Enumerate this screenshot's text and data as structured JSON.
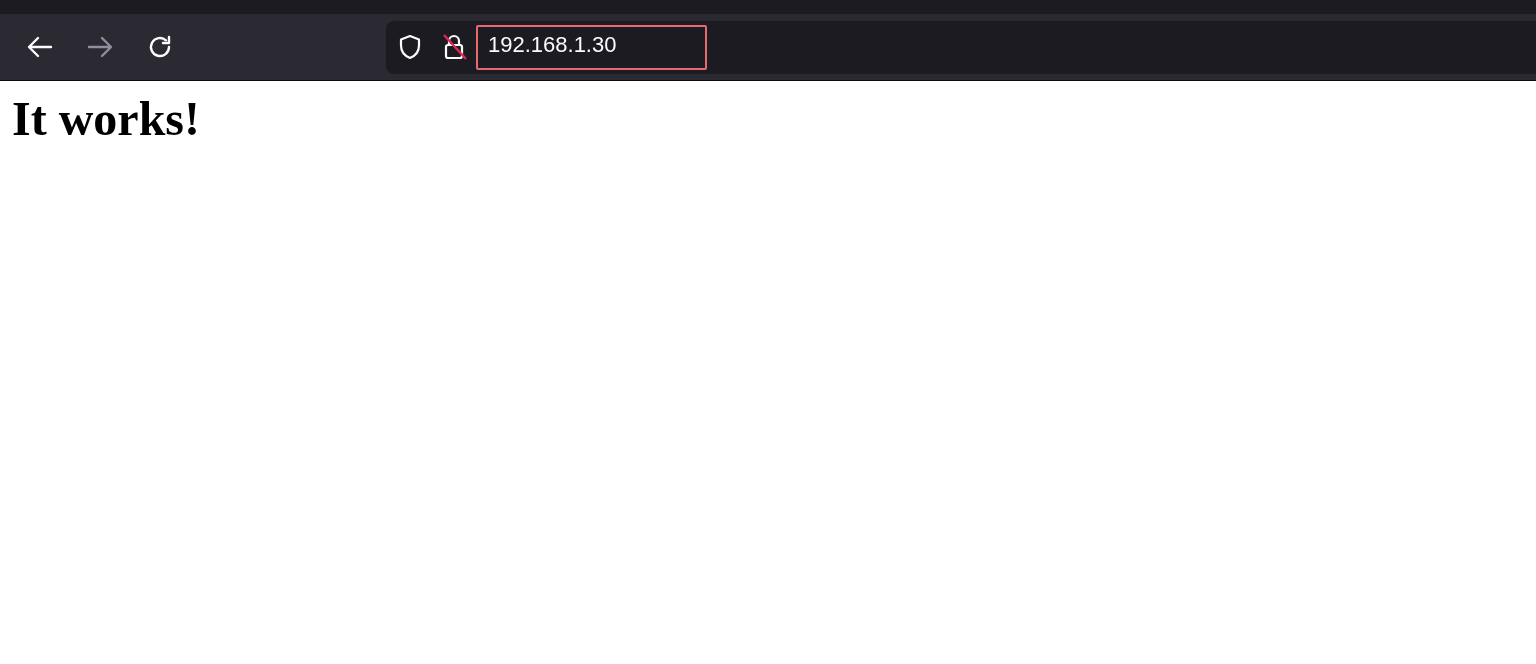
{
  "toolbar": {
    "back": {
      "disabled": false
    },
    "forward": {
      "disabled": true
    },
    "address_bar": {
      "value": "192.168.1.30",
      "highlighted": true,
      "insecure": true
    }
  },
  "page": {
    "heading": "It works!"
  }
}
